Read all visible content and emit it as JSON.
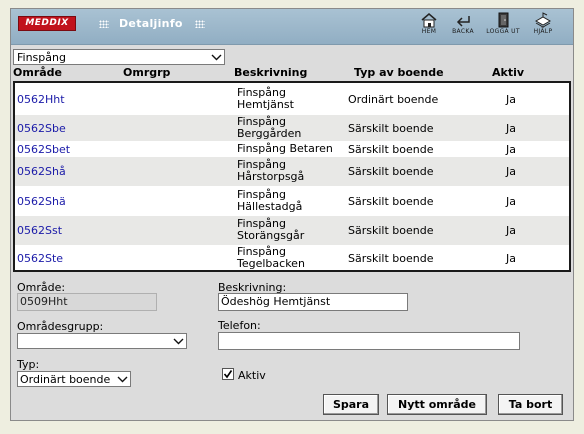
{
  "header": {
    "logo_text": "MEDDIX",
    "title": "Detaljinfo",
    "nav": [
      {
        "label": "HEM",
        "icon": "home-icon"
      },
      {
        "label": "BACKA",
        "icon": "back-arrow-icon"
      },
      {
        "label": "LOGGA UT",
        "icon": "logout-door-icon"
      },
      {
        "label": "HJÄLP",
        "icon": "help-book-icon"
      }
    ]
  },
  "filter": {
    "selected": "Finspång"
  },
  "columns": {
    "omrade": "Område",
    "omrgrp": "Omrgrp",
    "beskrivning": "Beskrivning",
    "typ": "Typ av boende",
    "aktiv": "Aktiv"
  },
  "rows": [
    {
      "code": "0562Hht",
      "desc1": "Finspång",
      "desc2": "Hemtjänst",
      "type": "Ordinärt boende",
      "active": "Ja"
    },
    {
      "code": "0562Sbe",
      "desc1": "Finspång",
      "desc2": "Berggården",
      "type": "Särskilt boende",
      "active": "Ja"
    },
    {
      "code": "0562Sbet",
      "desc1": "Finspång Betaren",
      "desc2": "",
      "type": "Särskilt boende",
      "active": "Ja"
    },
    {
      "code": "0562Shå",
      "desc1": "Finspång",
      "desc2": "Hårstorpsgå",
      "type": "Särskilt boende",
      "active": "Ja"
    },
    {
      "code": "0562Shä",
      "desc1": "Finspång",
      "desc2": "Hällestadgå",
      "type": "Särskilt boende",
      "active": "Ja"
    },
    {
      "code": "0562Sst",
      "desc1": "Finspång",
      "desc2": "Storängsgår",
      "type": "Särskilt boende",
      "active": "Ja"
    },
    {
      "code": "0562Ste",
      "desc1": "Finspång",
      "desc2": "Tegelbacken",
      "type": "Särskilt boende",
      "active": "Ja"
    }
  ],
  "form": {
    "omrade_label": "Område:",
    "omrade_value": "0509Hht",
    "beskrivning_label": "Beskrivning:",
    "beskrivning_value": "Ödeshög Hemtjänst",
    "omradesgrupp_label": "Områdesgrupp:",
    "omradesgrupp_value": "",
    "telefon_label": "Telefon:",
    "telefon_value": "",
    "typ_label": "Typ:",
    "typ_value": "Ordinärt boende",
    "aktiv_label": "Aktiv",
    "aktiv_checked": true
  },
  "buttons": {
    "save": "Spara",
    "new": "Nytt område",
    "delete": "Ta bort"
  },
  "colors": {
    "header_bg": "#9db7c9",
    "logo_red": "#c1121c",
    "code_link": "#1a1aa8",
    "row_alt": "#e8e8e6"
  }
}
